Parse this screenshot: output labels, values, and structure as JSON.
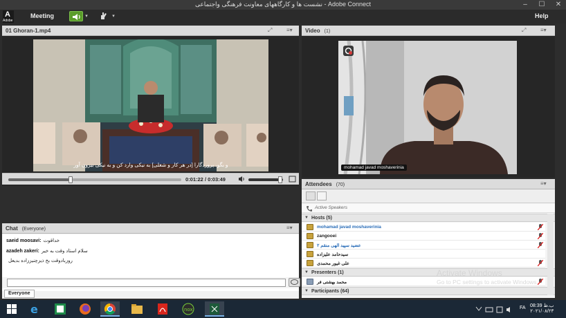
{
  "window": {
    "title": "نشست ها و کارگاههای معاونت فرهنگی واجتماعی - Adobe Connect",
    "minimize": "–",
    "maximize": "☐",
    "close": "✕"
  },
  "menubar": {
    "logo_letter": "A",
    "logo_text": "Adobe",
    "meeting": "Meeting",
    "help": "Help",
    "speaker_active_color": "#5a9c2a"
  },
  "video_pod": {
    "title": "01 Ghoran-1.mp4",
    "subtitle": "و بگو، پروردگارا [در هر کار و شغلی] به نیکی وارد کن و به نیکی بیرون آور",
    "current_time": "0:01:22",
    "duration": "0:03:49",
    "progress_fraction": 0.358,
    "volume_fraction": 0.92
  },
  "webcam_pod": {
    "title": "Video",
    "count": "(1)",
    "participant_name": "mohamad javad moshaverinia"
  },
  "attendees_pod": {
    "title": "Attendees",
    "count": "(70)",
    "active_speakers_label": "Active Speakers",
    "hosts_label": "Hosts (5)",
    "presenters_label": "Presenters (1)",
    "participants_label": "Participants (64)",
    "hosts": [
      {
        "name": "mohamad javad moshaverinia",
        "highlight": true
      },
      {
        "name": "zangooei",
        "highlight": false
      },
      {
        "name": "عضید سپید الهی منقم ۲",
        "highlight": true
      },
      {
        "name": "سیدحامد علیزاده",
        "highlight": false
      },
      {
        "name": "علی غیور محمدی",
        "highlight": false
      }
    ],
    "presenters": [
      {
        "name": "محمد بهشتی فر"
      }
    ]
  },
  "chat_pod": {
    "title": "Chat",
    "subtitle": "(Everyone)",
    "messages": [
      {
        "sender": "saeid moosavi:",
        "text": "خداقوت"
      },
      {
        "sender": "azadeh zakeri:",
        "text": "سلام استاد وقت به خیر"
      },
      {
        "sender": "",
        "text": "روزبادوقت بخ ذیزچنیززاده بدیعل"
      }
    ],
    "tab_label": "Everyone"
  },
  "watermark": {
    "line1": "Activate Windows",
    "line2": "Go to PC settings to activate Windows."
  },
  "taskbar": {
    "time": "08:39 ب.ظ",
    "date": "۲۰۲۱/۰۸/۲۳",
    "language": "FA",
    "apps": [
      "start-button",
      "internet-explorer-icon",
      "excel-icon",
      "firefox-icon",
      "chrome-icon",
      "file-explorer-icon",
      "acrobat-icon",
      "nox-icon",
      "adobe-connect-icon"
    ]
  }
}
